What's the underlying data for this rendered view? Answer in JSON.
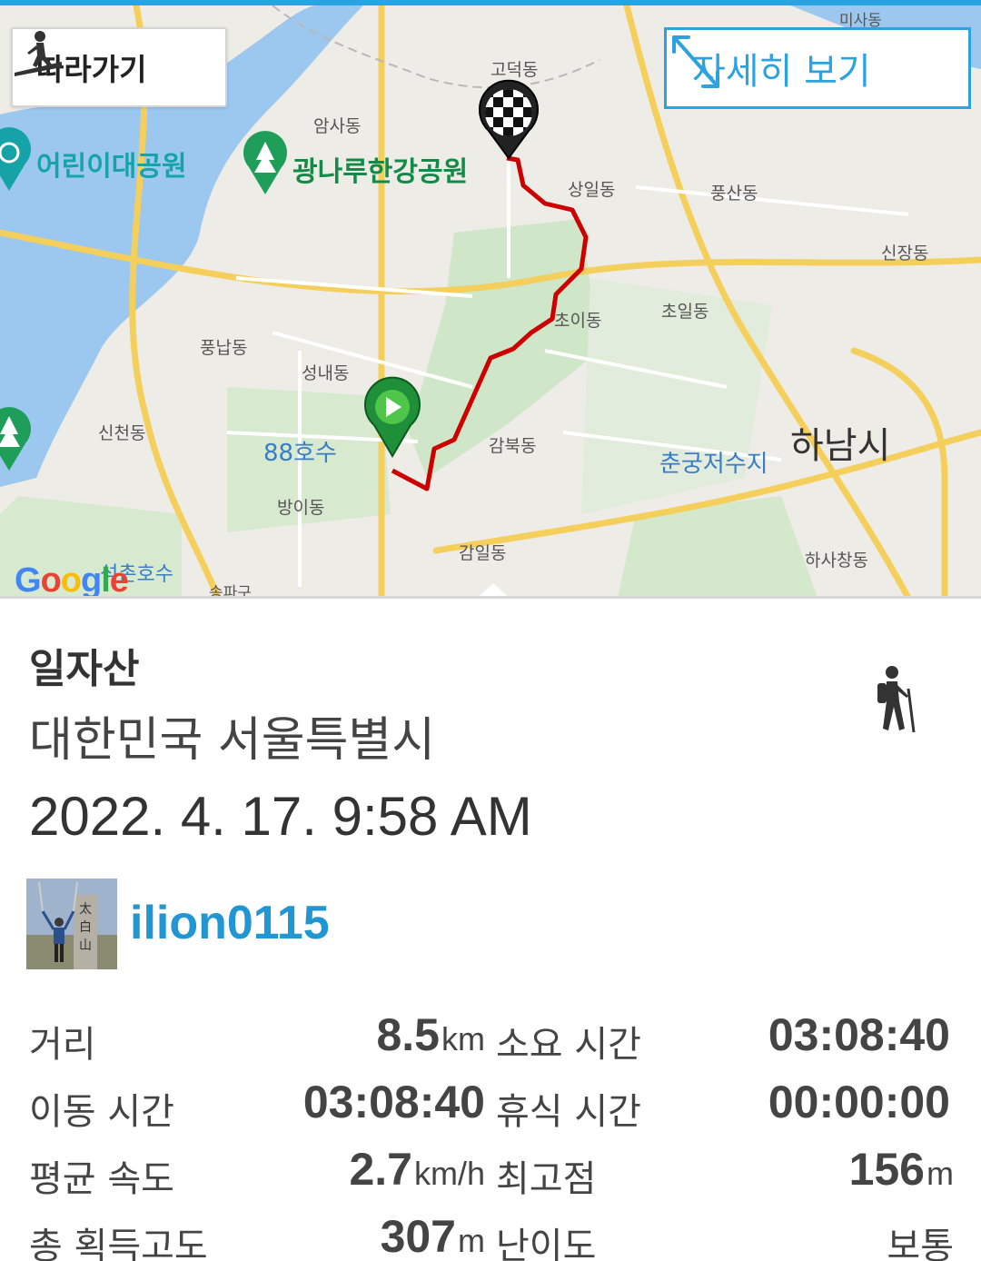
{
  "map": {
    "follow_label": "따라가기",
    "detail_label": "자세히 보기",
    "google_logo": "Google",
    "labels": {
      "godeok": "고덕동",
      "amsa": "암사동",
      "sangil": "상일동",
      "pungsan": "풍산동",
      "sinjang": "신장동",
      "choi": "초이동",
      "choil": "초일동",
      "pungnap": "풍납동",
      "seongnae": "성내동",
      "gobuk": "감북동",
      "hanam": "하남시",
      "chungung": "춘궁저수지",
      "lake88": "88호수",
      "bangi": "방이동",
      "gamil": "감일동",
      "hasachang": "하사창동",
      "sincheon": "신천동",
      "children_park": "어린이대공원",
      "gwangnaru_park": "광나루한강공원",
      "seokchon": "석촌호수",
      "songpa": "송파구",
      "misa": "미사동"
    }
  },
  "activity": {
    "title": "일자산",
    "location": "대한민국 서울특별시",
    "datetime": "2022. 4. 17. 9:58 AM",
    "activity_icon": "hiker-icon"
  },
  "user": {
    "name": "ilion0115",
    "avatar": "avatar-photo"
  },
  "stats": {
    "distance_label": "거리",
    "distance_value": "8.5",
    "distance_unit": "km",
    "duration_label": "소요 시간",
    "duration_value": "03:08:40",
    "moving_label": "이동 시간",
    "moving_value": "03:08:40",
    "rest_label": "휴식 시간",
    "rest_value": "00:00:00",
    "speed_label": "평균 속도",
    "speed_value": "2.7",
    "speed_unit": "km/h",
    "max_label": "최고점",
    "max_value": "156",
    "max_unit": "m",
    "gain_label": "총 획득고도",
    "gain_value": "307",
    "gain_unit": "m",
    "difficulty_label": "난이도",
    "difficulty_value": "보통"
  },
  "colors": {
    "accent": "#2aa3e0",
    "username": "#2196d3",
    "route": "#cc0000",
    "park": "#138a47",
    "water": "#9cc8f0"
  }
}
